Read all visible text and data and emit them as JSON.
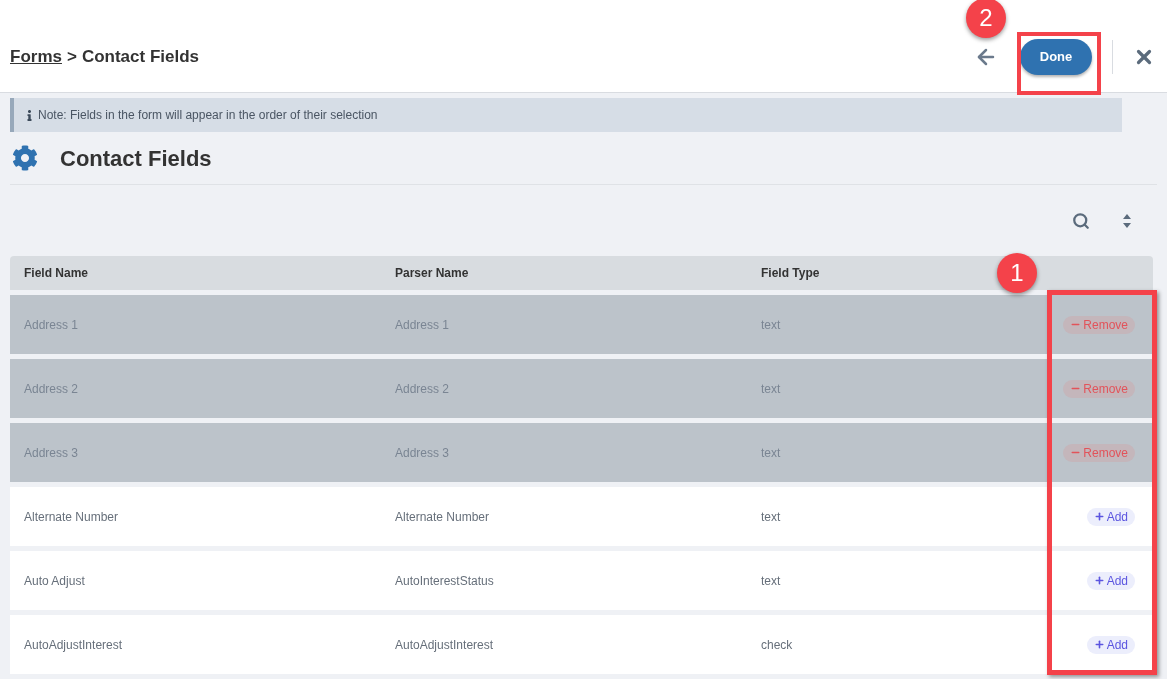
{
  "breadcrumb": {
    "link": "Forms",
    "separator": ">",
    "current": "Contact Fields"
  },
  "header": {
    "done_label": "Done"
  },
  "note": "Note: Fields in the form will appear in the order of their selection",
  "title": "Contact Fields",
  "table": {
    "columns": [
      "Field Name",
      "Parser Name",
      "Field Type"
    ],
    "rows": [
      {
        "field_name": "Address 1",
        "parser_name": "Address 1",
        "field_type": "text",
        "selected": true,
        "action": "Remove"
      },
      {
        "field_name": "Address 2",
        "parser_name": "Address 2",
        "field_type": "text",
        "selected": true,
        "action": "Remove"
      },
      {
        "field_name": "Address 3",
        "parser_name": "Address 3",
        "field_type": "text",
        "selected": true,
        "action": "Remove"
      },
      {
        "field_name": "Alternate Number",
        "parser_name": "Alternate Number",
        "field_type": "text",
        "selected": false,
        "action": "Add"
      },
      {
        "field_name": "Auto Adjust",
        "parser_name": "AutoInterestStatus",
        "field_type": "text",
        "selected": false,
        "action": "Add"
      },
      {
        "field_name": "AutoAdjustInterest",
        "parser_name": "AutoAdjustInterest",
        "field_type": "check",
        "selected": false,
        "action": "Add"
      }
    ]
  },
  "annotations": [
    {
      "label": "2"
    },
    {
      "label": "1"
    }
  ]
}
